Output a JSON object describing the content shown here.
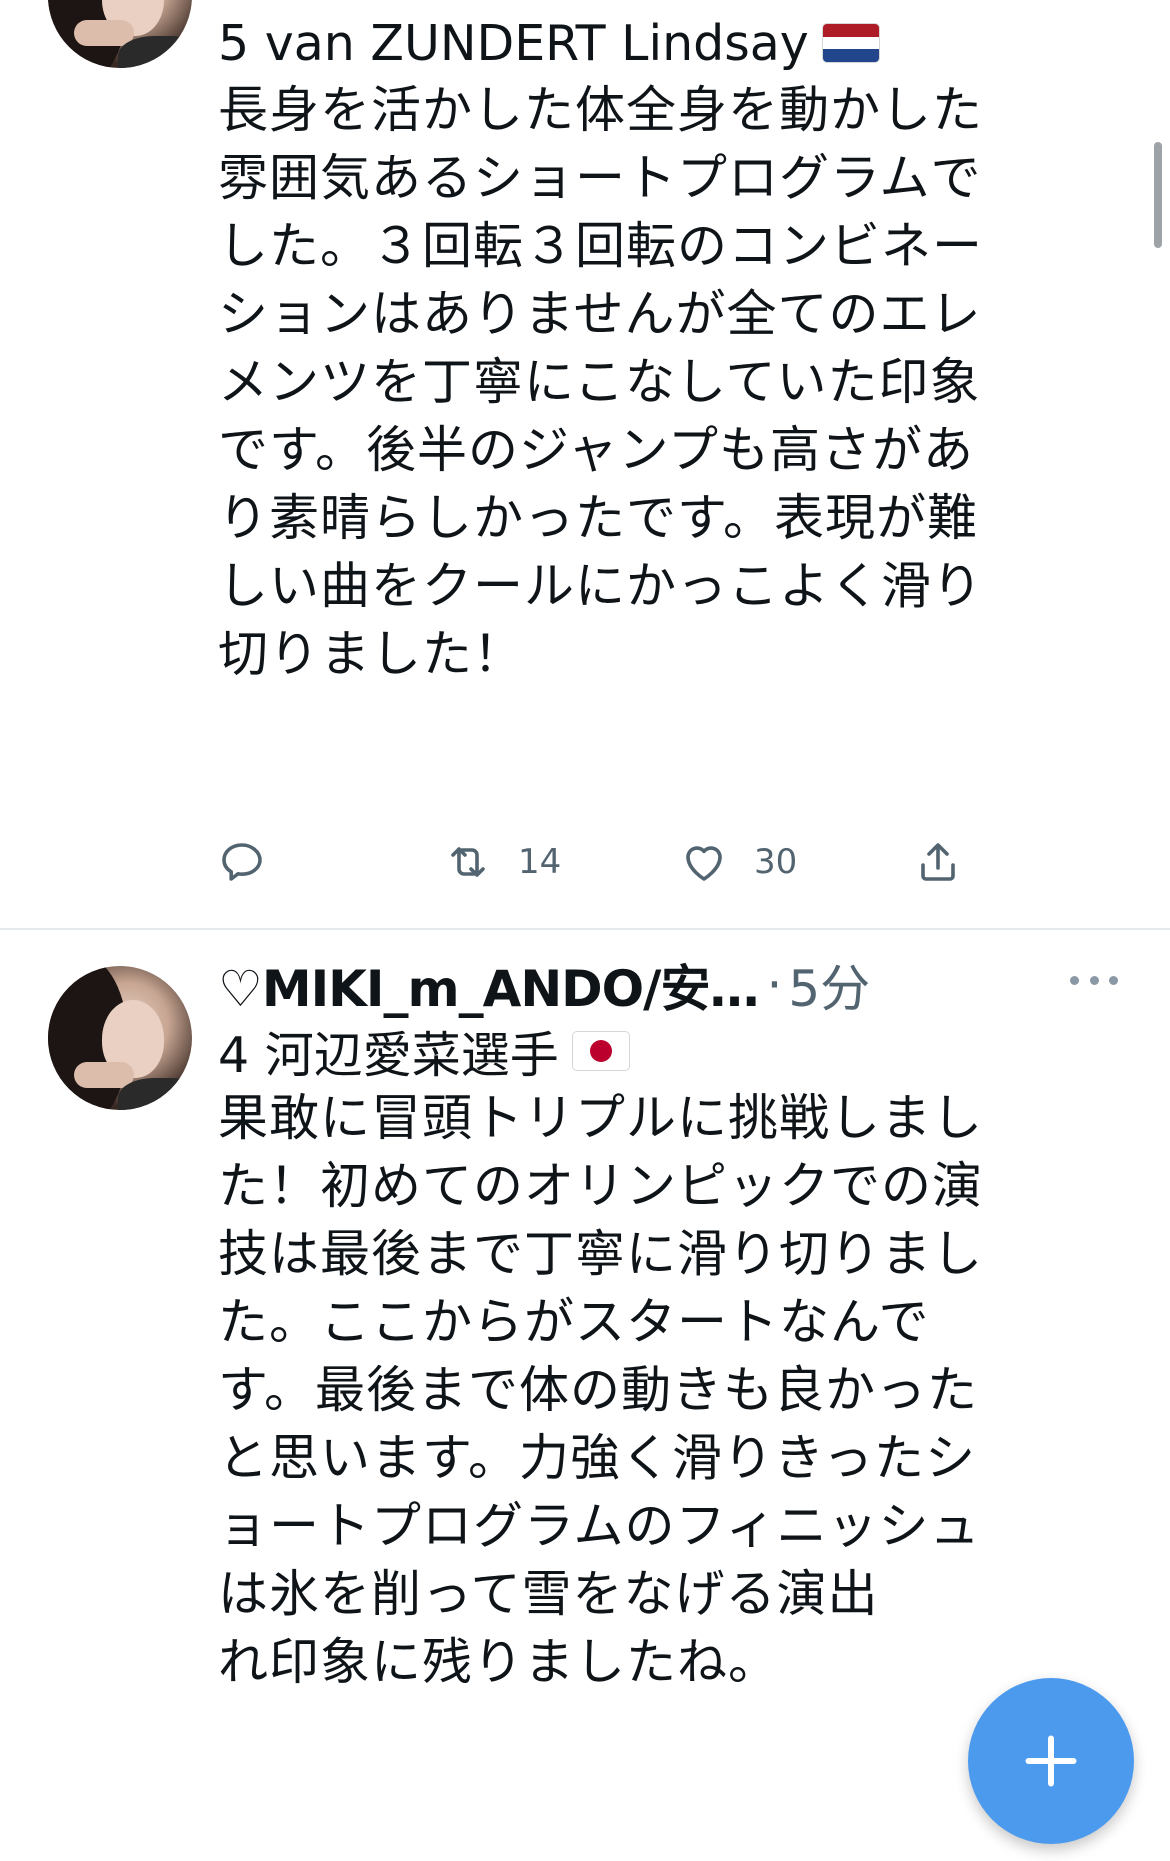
{
  "colors": {
    "accent": "#1d9bf0",
    "fab": "#4c9aed",
    "text": "#0f1419",
    "secondary": "#536471",
    "divider": "#e6e9ec"
  },
  "tweets": [
    {
      "avatar_icon": "avatar-photo",
      "first_line": "5 van ZUNDERT Lindsay",
      "flag_icon": "netherlands-flag-icon",
      "body": "長身を活かした体全身を動かした\n雰囲気あるショートプログラムで\nした。３回転３回転のコンビネー\nションはありませんが全てのエレ\nメンツを丁寧にこなしていた印象\nです。後半のジャンプも高さがあ\nり素晴らしかったです。表現が難\nしい曲をクールにかっこよく滑り\n切りました！",
      "actions": {
        "reply_count": "",
        "retweet_count": "14",
        "like_count": "30"
      }
    },
    {
      "avatar_icon": "avatar-photo",
      "display_name": "♡MIKI_m_ANDO/安…",
      "separator": "·",
      "timestamp": "5分",
      "more_icon": "more-options-icon",
      "first_line": "4 河辺愛菜選手",
      "flag_icon": "japan-flag-icon",
      "body": "果敢に冒頭トリプルに挑戦しまし\nた！初めてのオリンピックでの演\n技は最後まで丁寧に滑り切りまし\nた。ここからがスタートなんで\nす。最後まで体の動きも良かった\nと思います。力強く滑りきったシ\nョートプログラムのフィニッシュ\nは氷を削って雪をなげる演出\nれ印象に残りましたね。"
    }
  ],
  "fab": {
    "icon": "plus-icon"
  }
}
